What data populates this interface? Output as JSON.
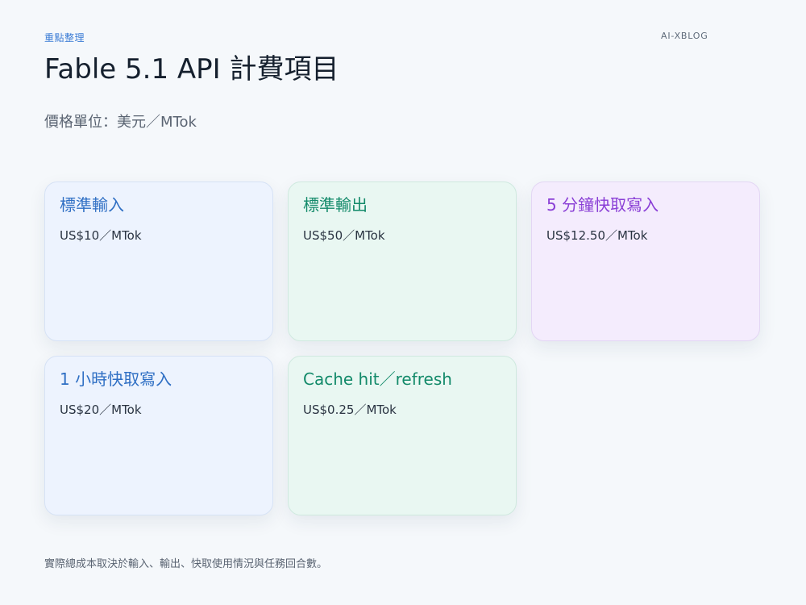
{
  "header": {
    "eyebrow": "重點整理",
    "brand": "AI-XBLOG",
    "title": "Fable 5.1 API 計費項目",
    "subtitle": "價格單位：美元／MTok"
  },
  "cards": [
    {
      "title": "標準輸入",
      "price": "US$10／MTok",
      "accent": "#2f6fc4"
    },
    {
      "title": "標準輸出",
      "price": "US$50／MTok",
      "accent": "#138a6a"
    },
    {
      "title": "5 分鐘快取寫入",
      "price": "US$12.50／MTok",
      "accent": "#8a3fd6"
    },
    {
      "title": "1 小時快取寫入",
      "price": "US$20／MTok",
      "accent": "#2f6fc4"
    },
    {
      "title": "Cache hit／refresh",
      "price": "US$0.25／MTok",
      "accent": "#138a6a"
    }
  ],
  "footer": {
    "note": "實際總成本取決於輸入、輸出、快取使用情況與任務回合數。"
  }
}
